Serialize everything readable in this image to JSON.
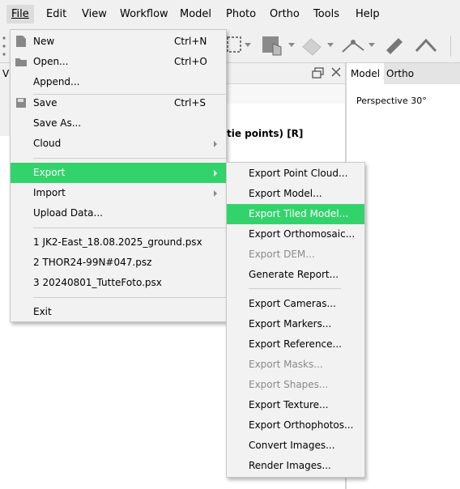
{
  "menubar": {
    "items": [
      "File",
      "Edit",
      "View",
      "Workflow",
      "Model",
      "Photo",
      "Ortho",
      "Tools",
      "Help"
    ]
  },
  "left_panel": {
    "label": "V"
  },
  "panel": {
    "tie_points_text": "tie points) [R]"
  },
  "model_view": {
    "tabs": [
      "Model",
      "Ortho"
    ],
    "perspective": "Perspective 30°"
  },
  "file_menu": {
    "new": {
      "label": "New",
      "shortcut": "Ctrl+N"
    },
    "open": {
      "label": "Open...",
      "shortcut": "Ctrl+O"
    },
    "append": {
      "label": "Append..."
    },
    "save": {
      "label": "Save",
      "shortcut": "Ctrl+S"
    },
    "save_as": {
      "label": "Save As..."
    },
    "cloud": {
      "label": "Cloud"
    },
    "export": {
      "label": "Export"
    },
    "import": {
      "label": "Import"
    },
    "upload": {
      "label": "Upload Data..."
    },
    "recent": [
      {
        "label": "1 JK2-East_18.08.2025_ground.psx"
      },
      {
        "label": "2 THOR24-99N#047.psz"
      },
      {
        "label": "3 20240801_TutteFoto.psx"
      }
    ],
    "exit": {
      "label": "Exit"
    }
  },
  "export_menu": {
    "items": [
      {
        "label": "Export Point Cloud...",
        "enabled": true
      },
      {
        "label": "Export Model...",
        "enabled": true
      },
      {
        "label": "Export Tiled Model...",
        "enabled": true,
        "highlighted": true
      },
      {
        "label": "Export Orthomosaic...",
        "enabled": true
      },
      {
        "label": "Export DEM...",
        "enabled": false
      },
      {
        "label": "Generate Report...",
        "enabled": true
      },
      {
        "label": "Export Cameras...",
        "enabled": true
      },
      {
        "label": "Export Markers...",
        "enabled": true
      },
      {
        "label": "Export Reference...",
        "enabled": true
      },
      {
        "label": "Export Masks...",
        "enabled": false
      },
      {
        "label": "Export Shapes...",
        "enabled": false
      },
      {
        "label": "Export Texture...",
        "enabled": true
      },
      {
        "label": "Export Orthophotos...",
        "enabled": true
      },
      {
        "label": "Convert Images...",
        "enabled": true
      },
      {
        "label": "Render Images...",
        "enabled": true
      }
    ]
  },
  "colors": {
    "highlight": "#33d36c",
    "menu_bg": "#f2f2f2",
    "disabled_text": "#8a8a8a"
  }
}
